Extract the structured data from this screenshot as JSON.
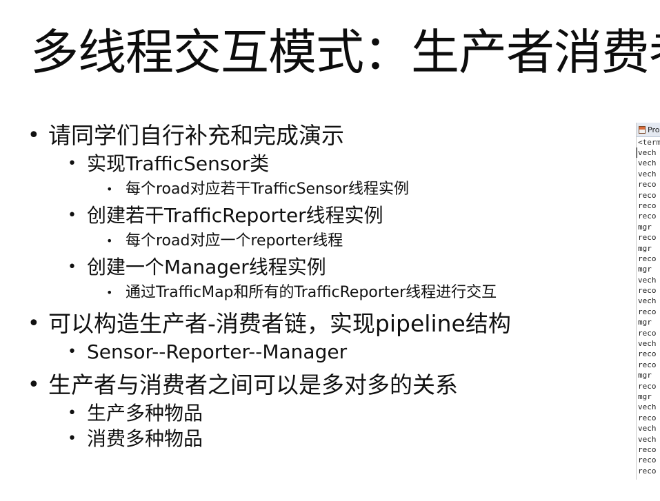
{
  "slide": {
    "title": "多线程交互模式：生产者消费者"
  },
  "bullets": [
    {
      "level": 1,
      "text": "请同学们自行补充和完成演示"
    },
    {
      "level": 2,
      "text": "实现TrafficSensor类"
    },
    {
      "level": 3,
      "text": "每个road对应若干TrafficSensor线程实例"
    },
    {
      "level": 2,
      "text": "创建若干TrafficReporter线程实例"
    },
    {
      "level": 3,
      "text": "每个road对应一个reporter线程"
    },
    {
      "level": 2,
      "text": "创建一个Manager线程实例"
    },
    {
      "level": 3,
      "text": "通过TrafficMap和所有的TrafficReporter线程进行交互"
    },
    {
      "level": 1,
      "text": "可以构造生产者-消费者链，实现pipeline结构"
    },
    {
      "level": 2,
      "text": "Sensor--Reporter--Manager"
    },
    {
      "level": 1,
      "text": "生产者与消费者之间可以是多对多的关系"
    },
    {
      "level": 2,
      "text": "生产多种物品"
    },
    {
      "level": 2,
      "text": "消费多种物品"
    }
  ],
  "console": {
    "tab_label": "Pro",
    "header": "<term",
    "lines": [
      "vech",
      "vech",
      "vech",
      "reco",
      "reco",
      "reco",
      "reco",
      "mgr",
      "reco",
      "mgr",
      "reco",
      "mgr",
      "vech",
      "reco",
      "vech",
      "reco",
      "mgr",
      "reco",
      "vech",
      "reco",
      "reco",
      "mgr",
      "reco",
      "mgr",
      "vech",
      "reco",
      "vech",
      "vech",
      "reco",
      "reco",
      "reco"
    ]
  }
}
